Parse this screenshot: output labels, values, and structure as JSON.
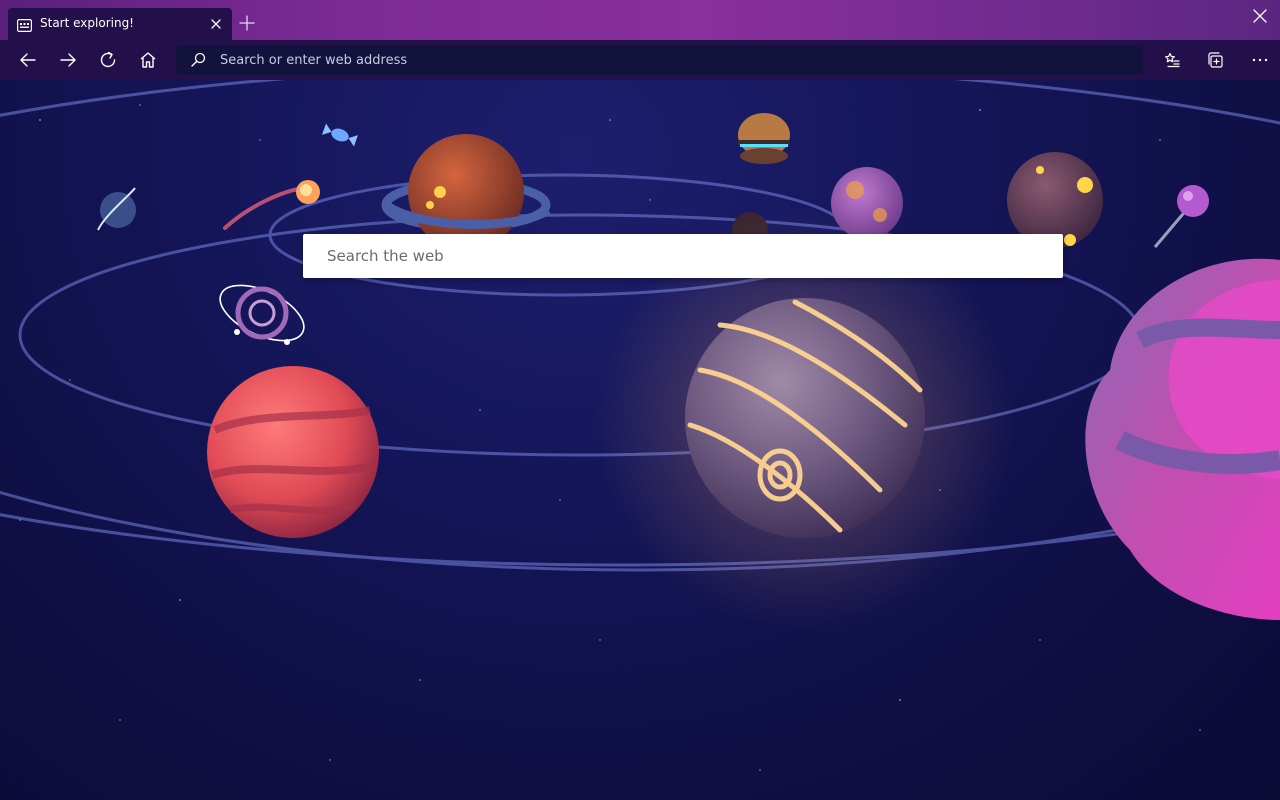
{
  "tab": {
    "title": "Start exploring!",
    "icon": "new-tab-page-icon",
    "close_icon": "close-icon"
  },
  "titlebar": {
    "new_tab_icon": "plus-icon",
    "close_window_icon": "close-icon"
  },
  "toolbar": {
    "back_icon": "arrow-left-icon",
    "forward_icon": "arrow-right-icon",
    "refresh_icon": "refresh-icon",
    "home_icon": "home-icon",
    "favorites_icon": "favorites-list-icon",
    "collections_icon": "collections-icon",
    "more_icon": "more-ellipsis-icon"
  },
  "address_bar": {
    "placeholder": "Search or enter web address",
    "icon": "search-icon"
  },
  "search": {
    "placeholder": "Search the web",
    "icon": "search-icon"
  },
  "colors": {
    "tab_bar_accent": "#7a2a95",
    "toolbar_bg": "#230f49",
    "address_bar_bg": "#13123c",
    "space_bg": "#15165a",
    "orbit_ring": "#6e7bd6"
  }
}
